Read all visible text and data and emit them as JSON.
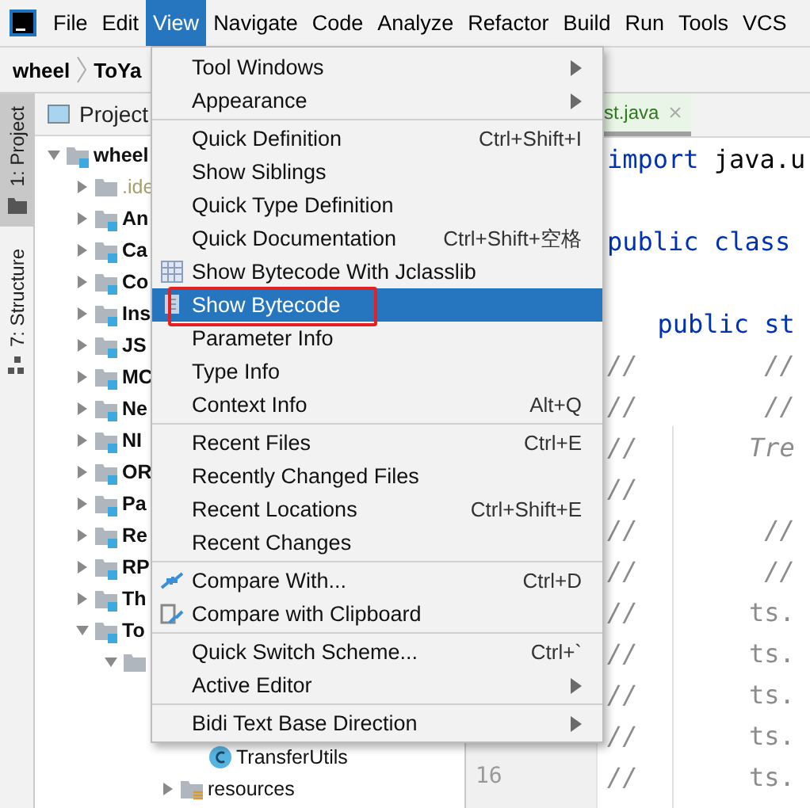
{
  "menubar": {
    "items": [
      {
        "label": "File",
        "selected": false
      },
      {
        "label": "Edit",
        "selected": false
      },
      {
        "label": "View",
        "selected": true
      },
      {
        "label": "Navigate",
        "selected": false
      },
      {
        "label": "Code",
        "selected": false
      },
      {
        "label": "Analyze",
        "selected": false
      },
      {
        "label": "Refactor",
        "selected": false
      },
      {
        "label": "Build",
        "selected": false
      },
      {
        "label": "Run",
        "selected": false
      },
      {
        "label": "Tools",
        "selected": false
      },
      {
        "label": "VCS",
        "selected": false
      }
    ]
  },
  "breadcrumb": [
    "wheel",
    "ToYa"
  ],
  "tool_strip": [
    {
      "label": "1: Project",
      "kind": "project",
      "selected": true
    },
    {
      "label": "7: Structure",
      "kind": "structure",
      "selected": false
    }
  ],
  "project_panel": {
    "title": "Project",
    "tree": [
      {
        "label": "wheel",
        "kind": "module",
        "expanded": true,
        "children": [
          {
            "label": ".ide",
            "kind": "excluded",
            "expanded": false
          },
          {
            "label": "An",
            "kind": "module",
            "expanded": false
          },
          {
            "label": "Ca",
            "kind": "module",
            "expanded": false
          },
          {
            "label": "Co",
            "kind": "module",
            "expanded": false
          },
          {
            "label": "Ins",
            "kind": "module",
            "expanded": false
          },
          {
            "label": "JS",
            "kind": "module",
            "expanded": false
          },
          {
            "label": "MC",
            "kind": "module",
            "expanded": false
          },
          {
            "label": "Ne",
            "kind": "module",
            "expanded": false
          },
          {
            "label": "NI",
            "kind": "module",
            "expanded": false
          },
          {
            "label": "OR",
            "kind": "module",
            "expanded": false
          },
          {
            "label": "Pa",
            "kind": "module",
            "expanded": false
          },
          {
            "label": "Re",
            "kind": "module",
            "expanded": false
          },
          {
            "label": "RP",
            "kind": "module",
            "expanded": false
          },
          {
            "label": "Th",
            "kind": "module",
            "expanded": false
          },
          {
            "label": "To",
            "kind": "module",
            "expanded": true,
            "children": [
              {
                "kind": "folder",
                "expanded": true,
                "children": [
                  {
                    "children": [
                      {
                        "children": [
                          {
                            "label": "TransferUtils",
                            "kind": "class"
                          }
                        ]
                      },
                      {
                        "label": "resources",
                        "kind": "resources",
                        "expanded": false
                      }
                    ]
                  }
                ]
              }
            ]
          }
        ]
      }
    ]
  },
  "editor": {
    "tab": {
      "label": "st.java",
      "selected": true
    },
    "lines": [
      {
        "kind": "top",
        "tokens": [
          {
            "text": "import",
            "kind": "keyword"
          },
          {
            "text": "java.u",
            "kind": "plain"
          }
        ]
      },
      {
        "kind": "blank"
      },
      {
        "kind": "top",
        "tokens": [
          {
            "text": "public class",
            "kind": "keyword"
          }
        ]
      },
      {
        "kind": "blank"
      },
      {
        "kind": "member",
        "tokens": [
          {
            "text": "public st",
            "kind": "keyword"
          }
        ]
      },
      {
        "kind": "body",
        "lead": "//",
        "tokens": [
          {
            "text": "//",
            "kind": "comment"
          }
        ]
      },
      {
        "kind": "body",
        "lead": "//",
        "tokens": [
          {
            "text": "//",
            "kind": "comment"
          }
        ]
      },
      {
        "kind": "body",
        "lead": "//",
        "tokens": [
          {
            "text": "Tre",
            "kind": "comment"
          }
        ]
      },
      {
        "kind": "body",
        "lead": "//"
      },
      {
        "kind": "body",
        "lead": "//",
        "tokens": [
          {
            "text": "//",
            "kind": "comment"
          }
        ]
      },
      {
        "kind": "body",
        "lead": "//",
        "tokens": [
          {
            "text": "//",
            "kind": "comment"
          }
        ]
      },
      {
        "kind": "body",
        "lead": "//",
        "tokens": [
          {
            "text": "ts.",
            "kind": "commented"
          }
        ]
      },
      {
        "kind": "body",
        "lead": "//",
        "tokens": [
          {
            "text": "ts.",
            "kind": "commented"
          }
        ]
      },
      {
        "kind": "body",
        "lead": "//",
        "tokens": [
          {
            "text": "ts.",
            "kind": "commented"
          }
        ]
      },
      {
        "kind": "body",
        "lead": "//",
        "tokens": [
          {
            "text": "ts.",
            "kind": "commented"
          }
        ]
      },
      {
        "kind": "body",
        "lead": "//",
        "line_number": "16",
        "tokens": [
          {
            "text": "ts.",
            "kind": "commented"
          }
        ]
      }
    ]
  },
  "view_menu": {
    "sections": [
      {
        "items": [
          {
            "label": "Tool Windows",
            "submenu": true,
            "selected": false,
            "outlined": false
          },
          {
            "label": "Appearance",
            "submenu": true,
            "selected": false,
            "outlined": false
          }
        ]
      },
      {
        "items": [
          {
            "label": "Quick Definition",
            "shortcut": "Ctrl+Shift+I",
            "submenu": false,
            "selected": false,
            "outlined": false
          },
          {
            "label": "Show Siblings",
            "submenu": false,
            "selected": false,
            "outlined": false
          },
          {
            "label": "Quick Type Definition",
            "submenu": false,
            "selected": false,
            "outlined": false
          },
          {
            "label": "Quick Documentation",
            "shortcut": "Ctrl+Shift+空格",
            "submenu": false,
            "selected": false,
            "outlined": false
          },
          {
            "label": "Show Bytecode With Jclasslib",
            "kind": "grid",
            "submenu": false,
            "selected": false,
            "outlined": false
          },
          {
            "label": "Show Bytecode",
            "kind": "document",
            "submenu": false,
            "selected": true,
            "outlined": true
          },
          {
            "label": "Parameter Info",
            "submenu": false,
            "selected": false,
            "outlined": false
          },
          {
            "label": "Type Info",
            "submenu": false,
            "selected": false,
            "outlined": false
          },
          {
            "label": "Context Info",
            "shortcut": "Alt+Q",
            "submenu": false,
            "selected": false,
            "outlined": false
          }
        ]
      },
      {
        "items": [
          {
            "label": "Recent Files",
            "shortcut": "Ctrl+E",
            "submenu": false,
            "selected": false,
            "outlined": false
          },
          {
            "label": "Recently Changed Files",
            "submenu": false,
            "selected": false,
            "outlined": false
          },
          {
            "label": "Recent Locations",
            "shortcut": "Ctrl+Shift+E",
            "submenu": false,
            "selected": false,
            "outlined": false
          },
          {
            "label": "Recent Changes",
            "submenu": false,
            "selected": false,
            "outlined": false
          }
        ]
      },
      {
        "items": [
          {
            "label": "Compare With...",
            "shortcut": "Ctrl+D",
            "kind": "compare",
            "submenu": false,
            "selected": false,
            "outlined": false
          },
          {
            "label": "Compare with Clipboard",
            "kind": "clipboard",
            "submenu": false,
            "selected": false,
            "outlined": false
          }
        ]
      },
      {
        "items": [
          {
            "label": "Quick Switch Scheme...",
            "shortcut": "Ctrl+`",
            "submenu": false,
            "selected": false,
            "outlined": false
          },
          {
            "label": "Active Editor",
            "submenu": true,
            "selected": false,
            "outlined": false
          }
        ]
      },
      {
        "items": [
          {
            "label": "Bidi Text Base Direction",
            "submenu": true,
            "selected": false,
            "outlined": false
          }
        ]
      }
    ]
  }
}
